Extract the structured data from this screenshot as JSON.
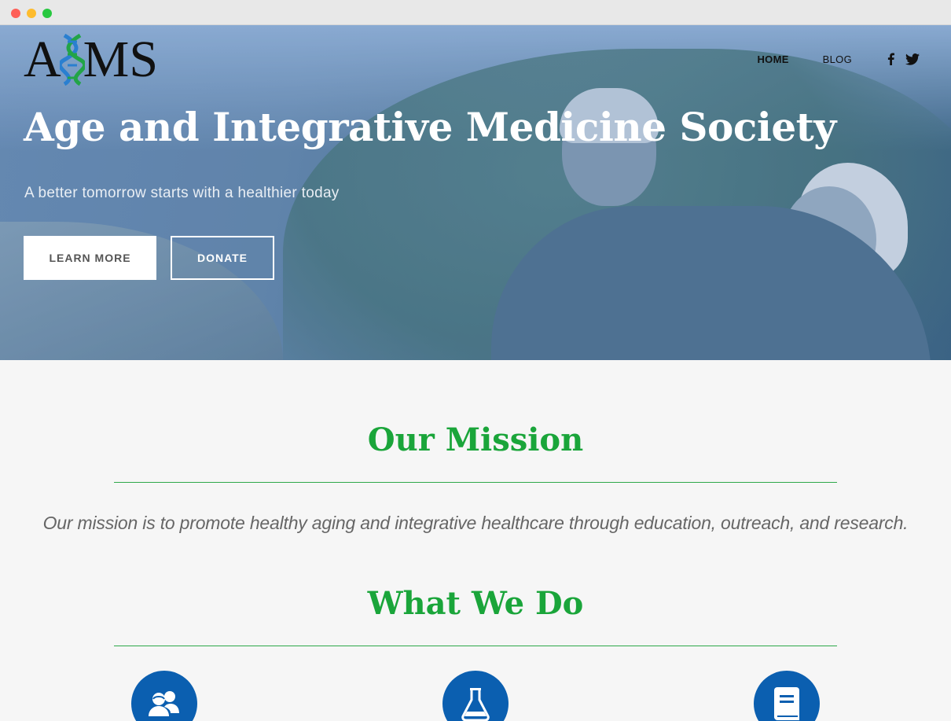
{
  "window": {
    "controls": [
      "close",
      "minimize",
      "maximize"
    ]
  },
  "logo": {
    "letter_a": "A",
    "letters_ms": "MS",
    "mark": "dna-icon"
  },
  "nav": {
    "items": [
      {
        "label": "HOME",
        "active": true
      },
      {
        "label": "BLOG",
        "active": false
      }
    ],
    "social": [
      "facebook-icon",
      "twitter-icon"
    ]
  },
  "hero": {
    "title": "Age and Integrative Medicine Society",
    "subtitle": "A better tomorrow starts with a healthier today",
    "buttons": {
      "learn_more": "LEARN MORE",
      "donate": "DONATE"
    }
  },
  "mission": {
    "heading": "Our Mission",
    "text": "Our mission is to promote healthy aging and integrative healthcare through education, outreach, and research."
  },
  "what_we_do": {
    "heading": "What We Do",
    "icons": [
      "people-icon",
      "flask-icon",
      "book-icon"
    ]
  },
  "colors": {
    "accent_green": "#1aa53a",
    "icon_blue": "#0b5fb0",
    "page_bg": "#f6f6f6"
  }
}
